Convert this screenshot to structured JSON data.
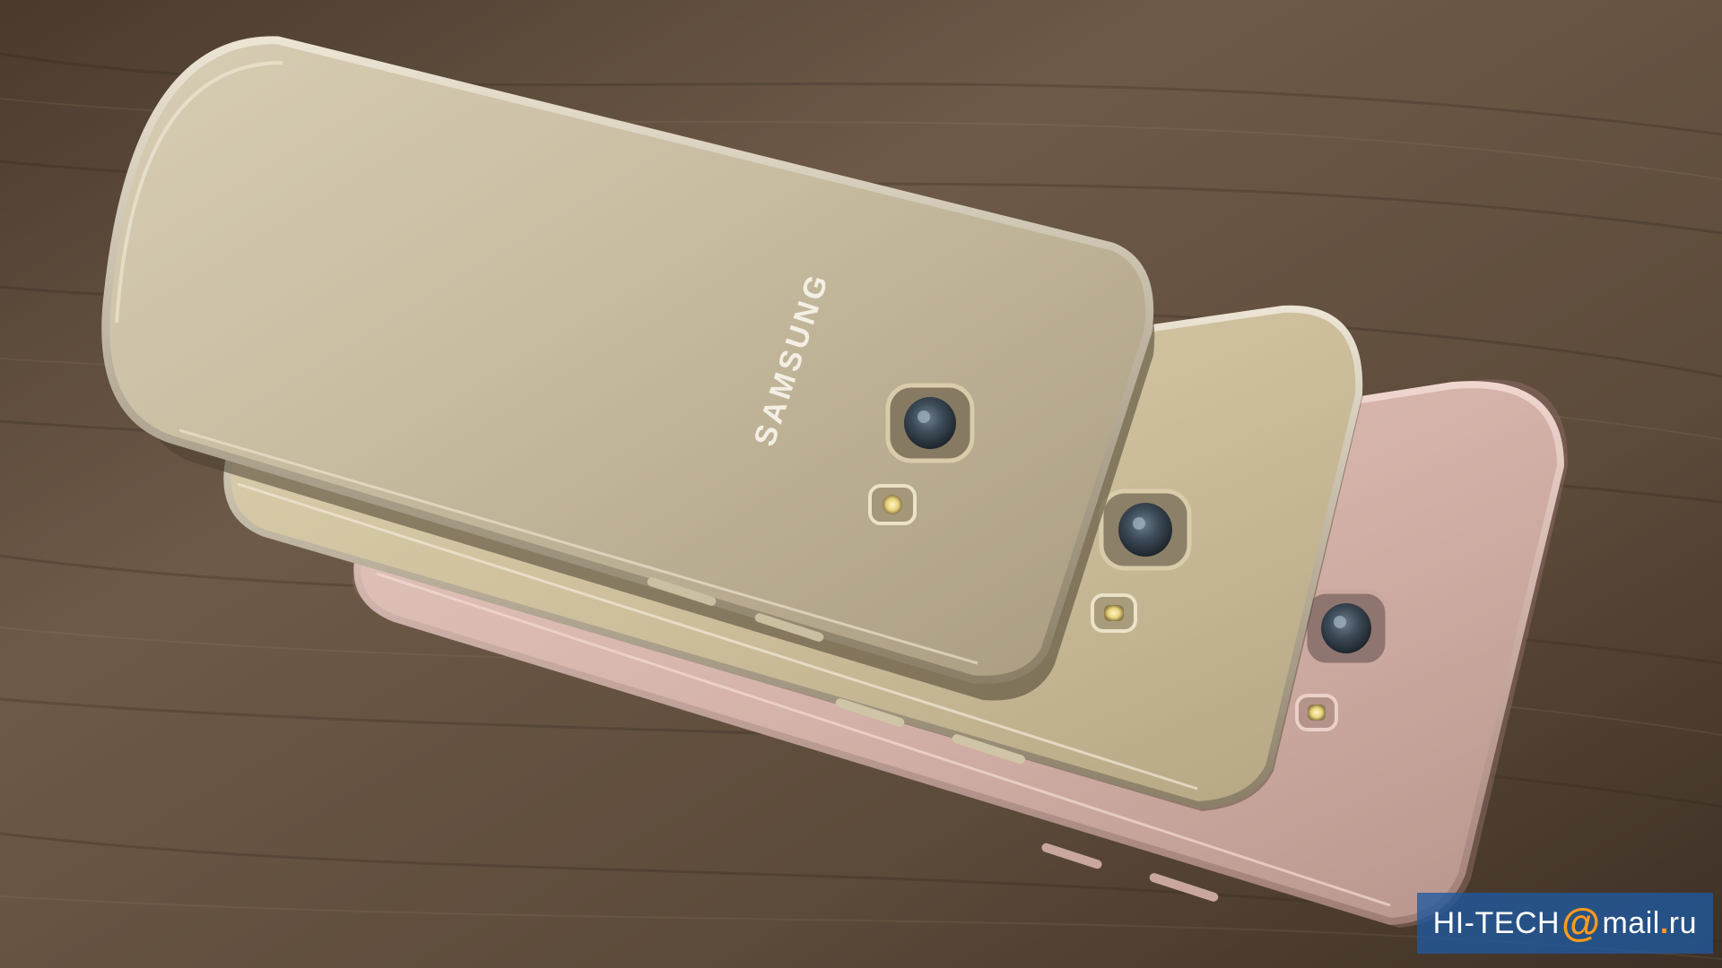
{
  "scene": {
    "background_color": "#5a4a3c",
    "phone_colors": {
      "front": "#c4b89c",
      "middle": "#cfc29f",
      "back": "#d3b1a9"
    }
  },
  "logo": {
    "text": "SAMSUNG"
  },
  "watermark": {
    "left": "HI-TECH",
    "at": "@",
    "right": "mail",
    "dot": ".",
    "tld": "ru",
    "bg_color": "#1f5aa0",
    "accent_color": "#ff9a1a"
  }
}
